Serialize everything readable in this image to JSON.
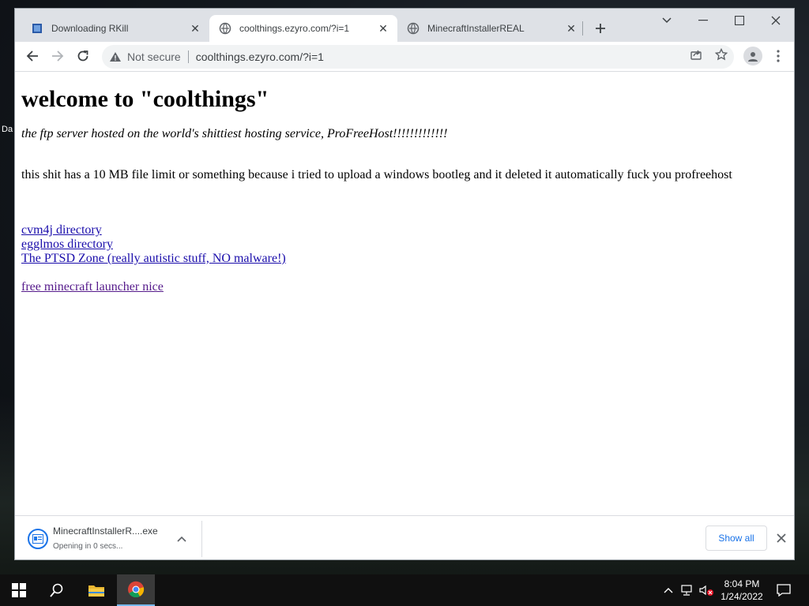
{
  "desktop": {
    "partial_label": "Da"
  },
  "browser": {
    "tabs": [
      {
        "title": "Downloading RKill",
        "icon": "rkill-icon",
        "active": false
      },
      {
        "title": "coolthings.ezyro.com/?i=1",
        "icon": "globe-icon",
        "active": true
      },
      {
        "title": "MinecraftInstallerREAL",
        "icon": "globe-icon",
        "active": false
      }
    ],
    "omnibox": {
      "security_label": "Not secure",
      "url": "coolthings.ezyro.com/?i=1"
    }
  },
  "page": {
    "heading": "welcome to \"coolthings\"",
    "tagline": "the ftp server hosted on the world's shittiest hosting service, ProFreeHost!!!!!!!!!!!!!",
    "rant": "this shit has a 10 MB file limit or something because i tried to upload a windows bootleg and it deleted it automatically fuck you profreehost",
    "links": [
      "cvm4j directory",
      "egglmos directory",
      "The PTSD Zone (really autistic stuff, NO malware!)"
    ],
    "extra_link": "free minecraft launcher nice"
  },
  "download_shelf": {
    "file_name": "MinecraftInstallerR....exe",
    "status": "Opening in 0 secs...",
    "show_all_label": "Show all"
  },
  "taskbar": {
    "time": "8:04 PM",
    "date": "1/24/2022"
  },
  "colors": {
    "link": "#1a0dab",
    "visited_link": "#551a8b",
    "accent": "#1a73e8",
    "tab_strip": "#dee1e6"
  }
}
